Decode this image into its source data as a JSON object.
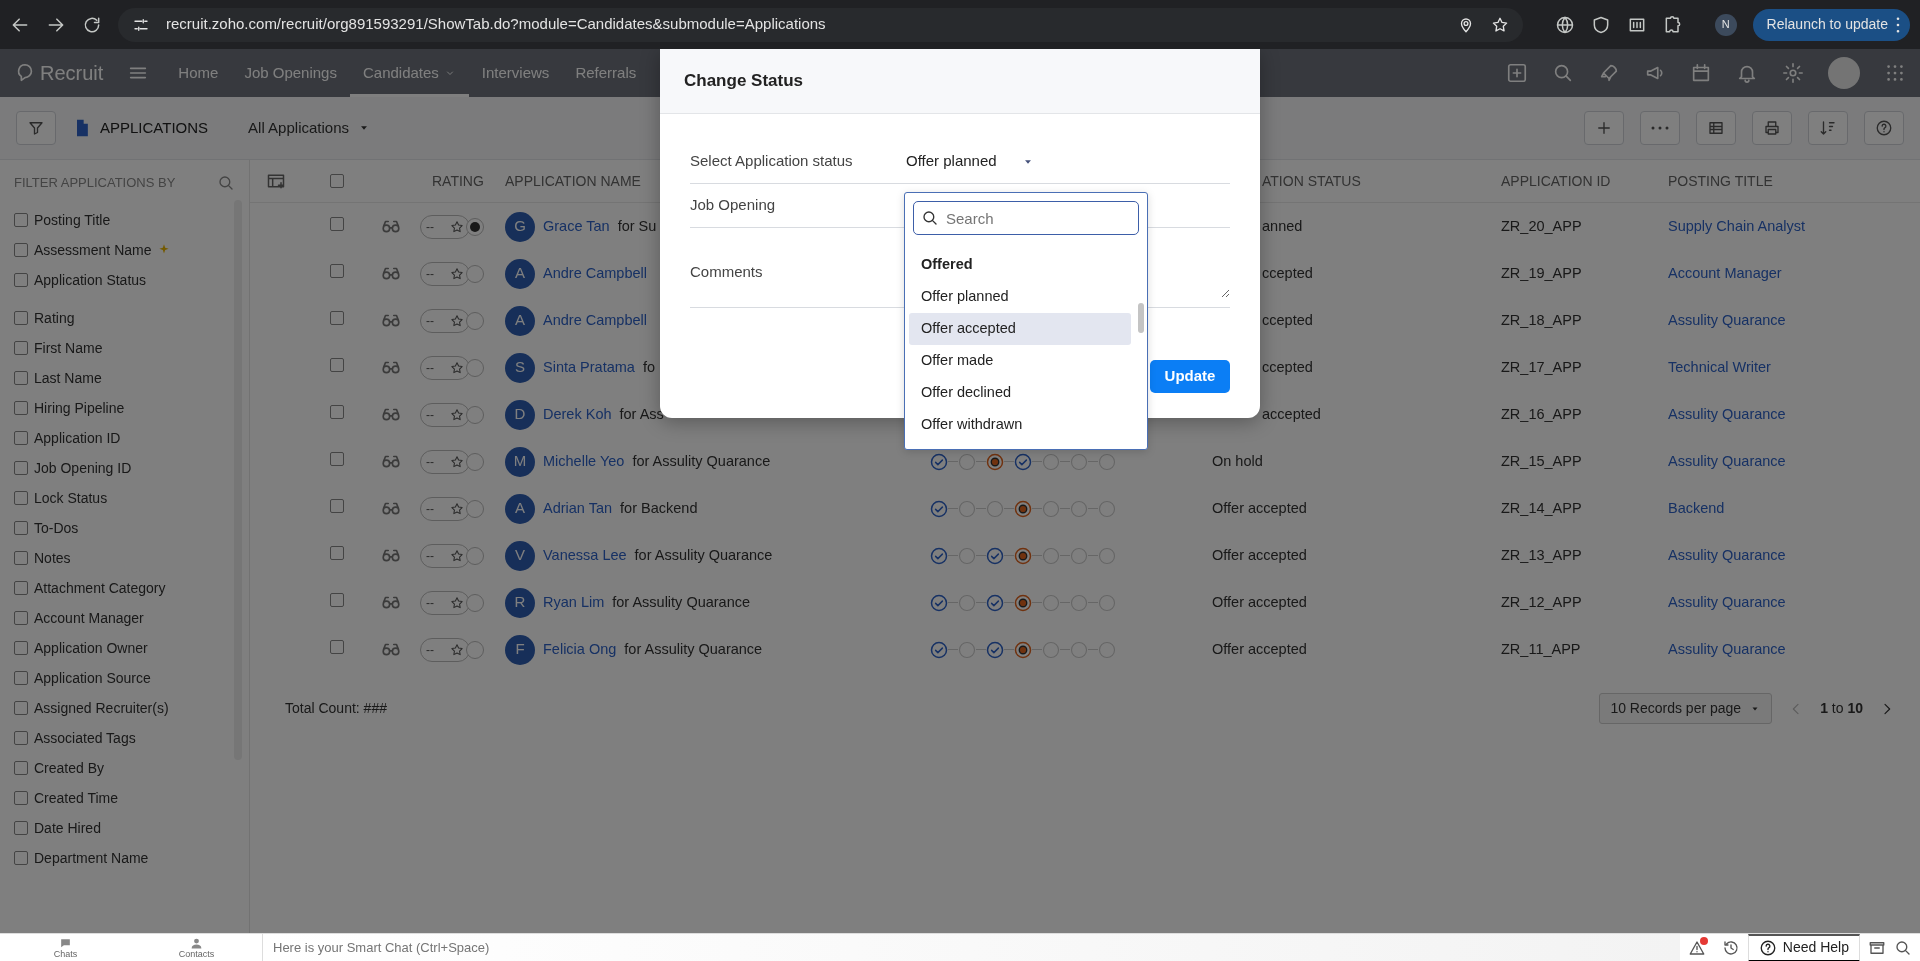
{
  "browser": {
    "url": "recruit.zoho.com/recruit/org891593291/ShowTab.do?module=Candidates&submodule=Applications",
    "profile_initial": "N",
    "relaunch": "Relaunch to update"
  },
  "app": {
    "name": "Recruit",
    "nav": [
      {
        "label": "Home",
        "selected": false,
        "has_menu": false
      },
      {
        "label": "Job Openings",
        "selected": false,
        "has_menu": false
      },
      {
        "label": "Candidates",
        "selected": true,
        "has_menu": true
      },
      {
        "label": "Interviews",
        "selected": false,
        "has_menu": false
      },
      {
        "label": "Referrals",
        "selected": false,
        "has_menu": false
      }
    ]
  },
  "toolbar": {
    "module": "APPLICATIONS",
    "view": "All Applications"
  },
  "sidebar": {
    "title": "FILTER APPLICATIONS BY",
    "groups": [
      [
        {
          "label": "Posting Title",
          "checked": false,
          "kind": "plain"
        },
        {
          "label": "Assessment Name",
          "checked": false,
          "kind": "ai"
        },
        {
          "label": "Application Status",
          "checked": false,
          "kind": "plain"
        }
      ],
      [
        {
          "label": "Rating",
          "checked": false,
          "kind": "plain"
        },
        {
          "label": "First Name",
          "checked": false,
          "kind": "plain"
        },
        {
          "label": "Last Name",
          "checked": false,
          "kind": "plain"
        },
        {
          "label": "Hiring Pipeline",
          "checked": false,
          "kind": "plain"
        },
        {
          "label": "Application ID",
          "checked": false,
          "kind": "plain"
        },
        {
          "label": "Job Opening ID",
          "checked": false,
          "kind": "plain"
        },
        {
          "label": "Lock Status",
          "checked": false,
          "kind": "plain"
        },
        {
          "label": "To-Dos",
          "checked": false,
          "kind": "plain"
        },
        {
          "label": "Notes",
          "checked": false,
          "kind": "plain"
        },
        {
          "label": "Attachment Category",
          "checked": false,
          "kind": "plain"
        },
        {
          "label": "Account Manager",
          "checked": false,
          "kind": "plain"
        },
        {
          "label": "Application Owner",
          "checked": false,
          "kind": "plain"
        },
        {
          "label": "Application Source",
          "checked": false,
          "kind": "plain"
        },
        {
          "label": "Assigned Recruiter(s)",
          "checked": false,
          "kind": "plain"
        },
        {
          "label": "Associated Tags",
          "checked": false,
          "kind": "plain"
        },
        {
          "label": "Created By",
          "checked": false,
          "kind": "plain"
        },
        {
          "label": "Created Time",
          "checked": false,
          "kind": "plain"
        },
        {
          "label": "Date Hired",
          "checked": false,
          "kind": "plain"
        },
        {
          "label": "Department Name",
          "checked": false,
          "kind": "plain"
        }
      ]
    ]
  },
  "table": {
    "header_checked": false,
    "columns": [
      {
        "kind": "rating",
        "label": "RATING"
      },
      {
        "kind": "name",
        "label": "APPLICATION NAME"
      },
      {
        "kind": "status",
        "label": "ATION STATUS"
      },
      {
        "kind": "id",
        "label": "APPLICATION ID"
      },
      {
        "kind": "posting",
        "label": "POSTING TITLE"
      }
    ],
    "rows": [
      {
        "checked": false,
        "selected": true,
        "rating": "--",
        "initial": "G",
        "candidate": "Grace Tan",
        "job_text": "for Su",
        "status_fragment": "anned",
        "app_id": "ZR_20_APP",
        "posting_title": "Supply Chain Analyst"
      },
      {
        "checked": false,
        "selected": false,
        "rating": "--",
        "initial": "A",
        "candidate": "Andre Campbell",
        "status_fragment": "ccepted",
        "app_id": "ZR_19_APP",
        "posting_title": "Account Manager"
      },
      {
        "checked": false,
        "selected": false,
        "rating": "--",
        "initial": "A",
        "candidate": "Andre Campbell",
        "status_fragment": "ccepted",
        "app_id": "ZR_18_APP",
        "posting_title": "Assulity Quarance"
      },
      {
        "checked": false,
        "selected": false,
        "rating": "--",
        "initial": "S",
        "candidate": "Sinta Pratama",
        "job_text": "fo",
        "status_fragment": "ccepted",
        "app_id": "ZR_17_APP",
        "posting_title": "Technical Writer"
      },
      {
        "checked": false,
        "selected": false,
        "rating": "--",
        "initial": "D",
        "candidate": "Derek Koh",
        "job_text": "for Ass",
        "status_fragment": "accepted",
        "app_id": "ZR_16_APP",
        "posting_title": "Assulity Quarance"
      },
      {
        "checked": false,
        "selected": false,
        "rating": "--",
        "initial": "M",
        "candidate": "Michelle Yeo",
        "job_text": "for Assulity Quarance",
        "pipeline": [
          {
            "kind": "done"
          },
          {
            "kind": "empty"
          },
          {
            "kind": "current"
          },
          {
            "kind": "done"
          },
          {
            "kind": "empty"
          },
          {
            "kind": "empty"
          },
          {
            "kind": "empty"
          }
        ],
        "status": "On hold",
        "app_id": "ZR_15_APP",
        "posting_title": "Assulity Quarance"
      },
      {
        "checked": false,
        "selected": false,
        "rating": "--",
        "initial": "A",
        "candidate": "Adrian Tan",
        "job_text": "for Backend",
        "pipeline": [
          {
            "kind": "done"
          },
          {
            "kind": "empty"
          },
          {
            "kind": "empty"
          },
          {
            "kind": "current"
          },
          {
            "kind": "empty"
          },
          {
            "kind": "empty"
          },
          {
            "kind": "empty"
          }
        ],
        "status": "Offer accepted",
        "app_id": "ZR_14_APP",
        "posting_title": "Backend"
      },
      {
        "checked": false,
        "selected": false,
        "rating": "--",
        "initial": "V",
        "candidate": "Vanessa Lee",
        "job_text": "for Assulity Quarance",
        "pipeline": [
          {
            "kind": "done"
          },
          {
            "kind": "empty"
          },
          {
            "kind": "done"
          },
          {
            "kind": "current"
          },
          {
            "kind": "empty"
          },
          {
            "kind": "empty"
          },
          {
            "kind": "empty"
          }
        ],
        "status": "Offer accepted",
        "app_id": "ZR_13_APP",
        "posting_title": "Assulity Quarance"
      },
      {
        "checked": false,
        "selected": false,
        "rating": "--",
        "initial": "R",
        "candidate": "Ryan Lim",
        "job_text": "for Assulity Quarance",
        "pipeline": [
          {
            "kind": "done"
          },
          {
            "kind": "empty"
          },
          {
            "kind": "done"
          },
          {
            "kind": "current"
          },
          {
            "kind": "empty"
          },
          {
            "kind": "empty"
          },
          {
            "kind": "empty"
          }
        ],
        "status": "Offer accepted",
        "app_id": "ZR_12_APP",
        "posting_title": "Assulity Quarance"
      },
      {
        "checked": false,
        "selected": false,
        "rating": "--",
        "initial": "F",
        "candidate": "Felicia Ong",
        "job_text": "for Assulity Quarance",
        "pipeline": [
          {
            "kind": "done"
          },
          {
            "kind": "empty"
          },
          {
            "kind": "done"
          },
          {
            "kind": "current"
          },
          {
            "kind": "empty"
          },
          {
            "kind": "empty"
          },
          {
            "kind": "empty"
          }
        ],
        "status": "Offer accepted",
        "app_id": "ZR_11_APP",
        "posting_title": "Assulity Quarance"
      }
    ],
    "total": "Total Count: ###",
    "page_size": "10 Records per page",
    "range": "**1** to **10**"
  },
  "modal": {
    "title": "Change Status",
    "fields": [
      {
        "kind": "select",
        "label": "Select Application status",
        "value": "Offer planned"
      },
      {
        "kind": "text",
        "label": "Job Opening"
      },
      {
        "kind": "textarea",
        "label": "Comments"
      }
    ],
    "primary_button": "Update"
  },
  "dropdown": {
    "placeholder": "Search",
    "items": [
      {
        "kind": "group",
        "label": "Offered",
        "selected": false
      },
      {
        "kind": "option",
        "label": "Offer planned",
        "selected": false
      },
      {
        "kind": "option",
        "label": "Offer accepted",
        "selected": true
      },
      {
        "kind": "option",
        "label": "Offer made",
        "selected": false
      },
      {
        "kind": "option",
        "label": "Offer declined",
        "selected": false
      },
      {
        "kind": "option",
        "label": "Offer withdrawn",
        "selected": false
      }
    ]
  },
  "chat_bar": {
    "tabs": [
      "Chats",
      "Contacts"
    ],
    "placeholder": "Here is your Smart Chat (Ctrl+Space)",
    "alert_unread": true,
    "help": "Need Help"
  }
}
